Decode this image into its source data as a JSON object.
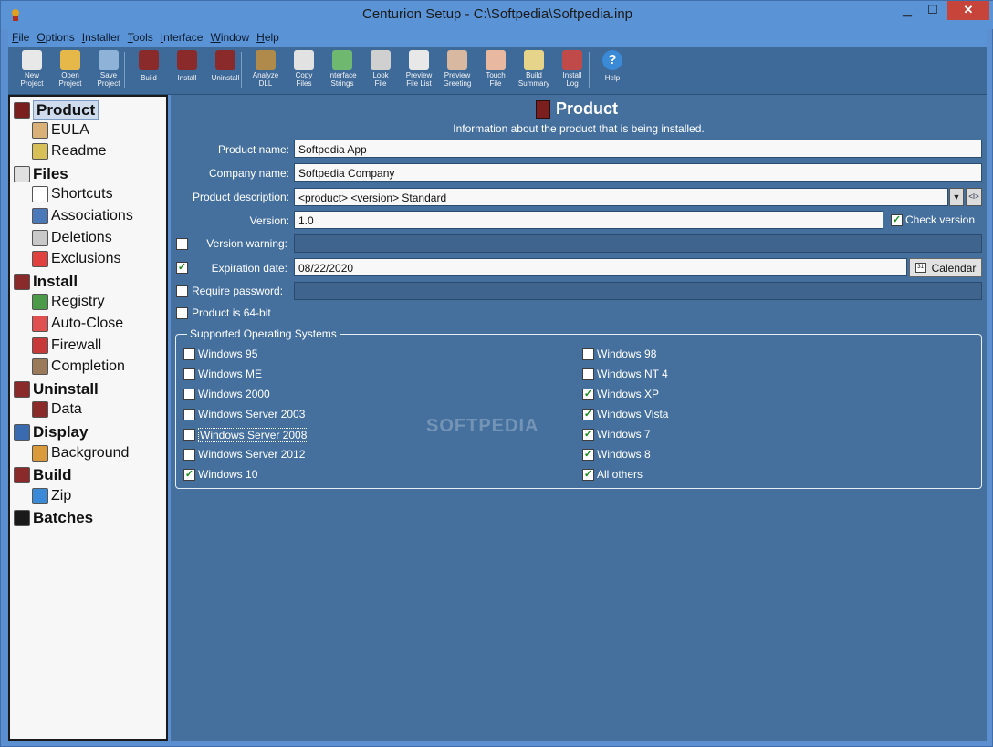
{
  "window": {
    "title": "Centurion Setup - C:\\Softpedia\\Softpedia.inp"
  },
  "menubar": [
    {
      "key": "F",
      "rest": "ile"
    },
    {
      "key": "O",
      "rest": "ptions"
    },
    {
      "key": "I",
      "rest": "nstaller"
    },
    {
      "key": "T",
      "rest": "ools"
    },
    {
      "key": "I",
      "rest": "nterface"
    },
    {
      "key": "W",
      "rest": "indow"
    },
    {
      "key": "H",
      "rest": "elp"
    }
  ],
  "toolbar": [
    {
      "name": "new-project",
      "label": "New\nProject",
      "color": "#e8e8e8"
    },
    {
      "name": "open-project",
      "label": "Open\nProject",
      "color": "#e6b84a"
    },
    {
      "name": "save-project",
      "label": "Save\nProject",
      "color": "#8fb3d8"
    },
    {
      "name": "build",
      "label": "Build",
      "color": "#8a2a2a"
    },
    {
      "name": "install",
      "label": "Install",
      "color": "#8a2a2a"
    },
    {
      "name": "uninstall",
      "label": "Uninstall",
      "color": "#8a2a2a"
    },
    {
      "name": "analyze-dll",
      "label": "Analyze\nDLL",
      "color": "#b08a4a"
    },
    {
      "name": "copy-files",
      "label": "Copy\nFiles",
      "color": "#e2e2e2"
    },
    {
      "name": "interface-strings",
      "label": "Interface\nStrings",
      "color": "#6fb86f"
    },
    {
      "name": "look-file",
      "label": "Look\nFile",
      "color": "#d0d0d0"
    },
    {
      "name": "preview-file-list",
      "label": "Preview\nFile List",
      "color": "#e8e8e8"
    },
    {
      "name": "preview-greeting",
      "label": "Preview\nGreeting",
      "color": "#d8b8a0"
    },
    {
      "name": "touch-file",
      "label": "Touch\nFile",
      "color": "#e8b8a0"
    },
    {
      "name": "build-summary",
      "label": "Build\nSummary",
      "color": "#e6d48a"
    },
    {
      "name": "install-log",
      "label": "Install\nLog",
      "color": "#c04a4a"
    },
    {
      "name": "help",
      "label": "Help",
      "color": "#3a8ad8"
    }
  ],
  "sidebar": [
    {
      "label": "Product",
      "level": "top",
      "icon": "product-icon",
      "color": "#7a1e1e",
      "selected": true
    },
    {
      "label": "EULA",
      "level": "sub",
      "icon": "eula-icon",
      "color": "#d8b078"
    },
    {
      "label": "Readme",
      "level": "sub",
      "icon": "readme-icon",
      "color": "#d8c058"
    },
    {
      "label": "Files",
      "level": "top",
      "icon": "files-icon",
      "color": "#e0e0e0"
    },
    {
      "label": "Shortcuts",
      "level": "sub",
      "icon": "shortcuts-icon",
      "color": "#ffffff"
    },
    {
      "label": "Associations",
      "level": "sub",
      "icon": "associations-icon",
      "color": "#4a78b8"
    },
    {
      "label": "Deletions",
      "level": "sub",
      "icon": "deletions-icon",
      "color": "#c8c8c8"
    },
    {
      "label": "Exclusions",
      "level": "sub",
      "icon": "exclusions-icon",
      "color": "#e04040"
    },
    {
      "label": "Install",
      "level": "top",
      "icon": "install-icon",
      "color": "#8a2a2a"
    },
    {
      "label": "Registry",
      "level": "sub",
      "icon": "registry-icon",
      "color": "#4a9a4a"
    },
    {
      "label": "Auto-Close",
      "level": "sub",
      "icon": "auto-close-icon",
      "color": "#e05050"
    },
    {
      "label": "Firewall",
      "level": "sub",
      "icon": "firewall-icon",
      "color": "#c83a3a"
    },
    {
      "label": "Completion",
      "level": "sub",
      "icon": "completion-icon",
      "color": "#9a7a5a"
    },
    {
      "label": "Uninstall",
      "level": "top",
      "icon": "uninstall-icon",
      "color": "#8a2a2a"
    },
    {
      "label": "Data",
      "level": "sub",
      "icon": "data-icon",
      "color": "#8a2a2a"
    },
    {
      "label": "Display",
      "level": "top",
      "icon": "display-icon",
      "color": "#3a6ab0"
    },
    {
      "label": "Background",
      "level": "sub",
      "icon": "background-icon",
      "color": "#d89a3a"
    },
    {
      "label": "Build",
      "level": "top",
      "icon": "build-icon",
      "color": "#8a2a2a"
    },
    {
      "label": "Zip",
      "level": "sub",
      "icon": "zip-icon",
      "color": "#3a8ad8"
    },
    {
      "label": "Batches",
      "level": "top",
      "icon": "batches-icon",
      "color": "#1a1a1a"
    }
  ],
  "main": {
    "title": "Product",
    "subtitle": "Information about the product that is being installed.",
    "product_name_label": "Product name:",
    "product_name_value": "Softpedia App",
    "company_name_label": "Company name:",
    "company_name_value": "Softpedia Company",
    "product_description_label": "Product description:",
    "product_description_value": "<product> <version> Standard",
    "version_label": "Version:",
    "version_value": "1.0",
    "check_version_label": "Check version",
    "check_version_checked": "✓",
    "version_warning_label": "Version warning:",
    "expiration_date_label": "Expiration date:",
    "expiration_date_value": "08/22/2020",
    "expiration_checked": "✓",
    "calendar_label": "Calendar",
    "require_password_label": "Require password:",
    "product_64bit_label": "Product is 64-bit",
    "macro_label": "<I>",
    "dropdown_arrow": "▼"
  },
  "os_group": {
    "legend": "Supported Operating Systems",
    "left": [
      {
        "label": "Windows 95",
        "checked": ""
      },
      {
        "label": "Windows ME",
        "checked": ""
      },
      {
        "label": "Windows 2000",
        "checked": ""
      },
      {
        "label": "Windows Server 2003",
        "checked": ""
      },
      {
        "label": "Windows Server 2008",
        "checked": "",
        "focused": true
      },
      {
        "label": "Windows Server 2012",
        "checked": ""
      },
      {
        "label": "Windows 10",
        "checked": "✓"
      }
    ],
    "right": [
      {
        "label": "Windows 98",
        "checked": ""
      },
      {
        "label": "Windows NT 4",
        "checked": ""
      },
      {
        "label": "Windows XP",
        "checked": "✓"
      },
      {
        "label": "Windows Vista",
        "checked": "✓"
      },
      {
        "label": "Windows 7",
        "checked": "✓"
      },
      {
        "label": "Windows 8",
        "checked": "✓"
      },
      {
        "label": "All others",
        "checked": "✓"
      }
    ]
  },
  "watermark": "SOFTPEDIA"
}
